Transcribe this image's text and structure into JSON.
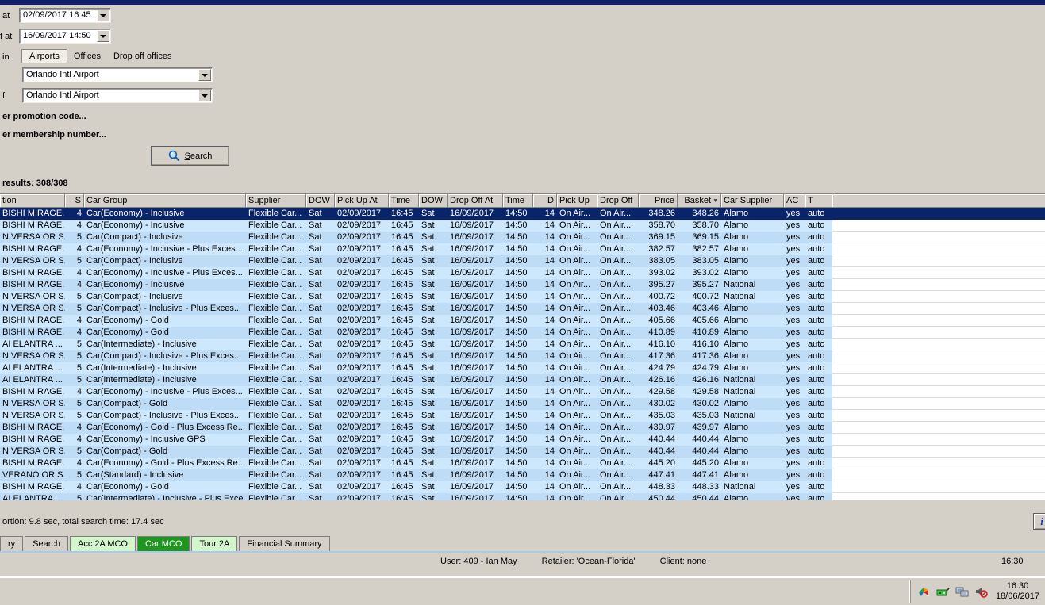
{
  "form": {
    "pickup_at_label": "at",
    "pickup_at_value": "02/09/2017 16:45",
    "dropoff_at_label": "f at",
    "dropoff_at_value": "16/09/2017 14:50",
    "location_in_label": "in",
    "location_tabs": [
      "Airports",
      "Offices",
      "Drop off offices"
    ],
    "active_location_tab": "Airports",
    "pickup_location_value": "Orlando Intl Airport",
    "dropoff_location_label": "f",
    "dropoff_location_value": "Orlando Intl Airport",
    "promotion_link": "er promotion code...",
    "membership_link": "er membership number...",
    "search_button_label": "Search",
    "results_count": "results: 308/308"
  },
  "table": {
    "headers": [
      "tion",
      "S",
      "Car Group",
      "Supplier",
      "DOW",
      "Pick Up At",
      "Time",
      "DOW",
      "Drop Off At",
      "Time",
      "D",
      "Pick Up",
      "Drop Off",
      "Price",
      "Basket",
      "Car Supplier",
      "AC",
      "T"
    ],
    "sorted_by": "Basket",
    "common": {
      "supplier": "Flexible Car...",
      "dow_pickup": "Sat",
      "pickup_date": "02/09/2017",
      "pickup_time": "16:45",
      "dow_dropoff": "Sat",
      "dropoff_date": "16/09/2017",
      "dropoff_time": "14:50",
      "days": "14",
      "pickup_loc": "On Air...",
      "dropoff_loc": "On Air...",
      "ac": "yes",
      "t": "auto"
    },
    "rows": [
      {
        "description": "BISHI MIRAGE...",
        "s": "4",
        "car_group": "Car(Economy) - Inclusive",
        "price": "348.26",
        "basket": "348.26",
        "car_supplier": "Alamo",
        "selected": true
      },
      {
        "description": "BISHI MIRAGE...",
        "s": "4",
        "car_group": "Car(Economy) - Inclusive",
        "price": "358.70",
        "basket": "358.70",
        "car_supplier": "Alamo"
      },
      {
        "description": "N VERSA OR S...",
        "s": "5",
        "car_group": "Car(Compact) - Inclusive",
        "price": "369.15",
        "basket": "369.15",
        "car_supplier": "Alamo"
      },
      {
        "description": "BISHI MIRAGE...",
        "s": "4",
        "car_group": "Car(Economy) - Inclusive - Plus Exces...",
        "price": "382.57",
        "basket": "382.57",
        "car_supplier": "Alamo"
      },
      {
        "description": "N VERSA OR S...",
        "s": "5",
        "car_group": "Car(Compact) - Inclusive",
        "price": "383.05",
        "basket": "383.05",
        "car_supplier": "Alamo"
      },
      {
        "description": "BISHI MIRAGE...",
        "s": "4",
        "car_group": "Car(Economy) - Inclusive - Plus Exces...",
        "price": "393.02",
        "basket": "393.02",
        "car_supplier": "Alamo"
      },
      {
        "description": "BISHI MIRAGE...",
        "s": "4",
        "car_group": "Car(Economy) - Inclusive",
        "price": "395.27",
        "basket": "395.27",
        "car_supplier": "National"
      },
      {
        "description": "N VERSA OR S...",
        "s": "5",
        "car_group": "Car(Compact) - Inclusive",
        "price": "400.72",
        "basket": "400.72",
        "car_supplier": "National"
      },
      {
        "description": "N VERSA OR S...",
        "s": "5",
        "car_group": "Car(Compact) - Inclusive - Plus Exces...",
        "price": "403.46",
        "basket": "403.46",
        "car_supplier": "Alamo"
      },
      {
        "description": "BISHI MIRAGE...",
        "s": "4",
        "car_group": "Car(Economy) - Gold",
        "price": "405.66",
        "basket": "405.66",
        "car_supplier": "Alamo"
      },
      {
        "description": "BISHI MIRAGE...",
        "s": "4",
        "car_group": "Car(Economy) - Gold",
        "price": "410.89",
        "basket": "410.89",
        "car_supplier": "Alamo"
      },
      {
        "description": "AI ELANTRA ...",
        "s": "5",
        "car_group": "Car(Intermediate) - Inclusive",
        "price": "416.10",
        "basket": "416.10",
        "car_supplier": "Alamo"
      },
      {
        "description": "N VERSA OR S...",
        "s": "5",
        "car_group": "Car(Compact) - Inclusive - Plus Exces...",
        "price": "417.36",
        "basket": "417.36",
        "car_supplier": "Alamo"
      },
      {
        "description": "AI ELANTRA ...",
        "s": "5",
        "car_group": "Car(Intermediate) - Inclusive",
        "price": "424.79",
        "basket": "424.79",
        "car_supplier": "Alamo"
      },
      {
        "description": "AI ELANTRA ...",
        "s": "5",
        "car_group": "Car(Intermediate) - Inclusive",
        "price": "426.16",
        "basket": "426.16",
        "car_supplier": "National"
      },
      {
        "description": "BISHI MIRAGE...",
        "s": "4",
        "car_group": "Car(Economy) - Inclusive - Plus Exces...",
        "price": "429.58",
        "basket": "429.58",
        "car_supplier": "National"
      },
      {
        "description": "N VERSA OR S...",
        "s": "5",
        "car_group": "Car(Compact) - Gold",
        "price": "430.02",
        "basket": "430.02",
        "car_supplier": "Alamo"
      },
      {
        "description": "N VERSA OR S...",
        "s": "5",
        "car_group": "Car(Compact) - Inclusive - Plus Exces...",
        "price": "435.03",
        "basket": "435.03",
        "car_supplier": "National"
      },
      {
        "description": "BISHI MIRAGE...",
        "s": "4",
        "car_group": "Car(Economy) - Gold - Plus Excess Re...",
        "price": "439.97",
        "basket": "439.97",
        "car_supplier": "Alamo"
      },
      {
        "description": "BISHI MIRAGE...",
        "s": "4",
        "car_group": "Car(Economy) - Inclusive GPS",
        "price": "440.44",
        "basket": "440.44",
        "car_supplier": "Alamo"
      },
      {
        "description": "N VERSA OR S...",
        "s": "5",
        "car_group": "Car(Compact) - Gold",
        "price": "440.44",
        "basket": "440.44",
        "car_supplier": "Alamo"
      },
      {
        "description": "BISHI MIRAGE...",
        "s": "4",
        "car_group": "Car(Economy) - Gold - Plus Excess Re...",
        "price": "445.20",
        "basket": "445.20",
        "car_supplier": "Alamo"
      },
      {
        "description": "VERANO OR S...",
        "s": "5",
        "car_group": "Car(Standard) - Inclusive",
        "price": "447.41",
        "basket": "447.41",
        "car_supplier": "Alamo"
      },
      {
        "description": "BISHI MIRAGE...",
        "s": "4",
        "car_group": "Car(Economy) - Gold",
        "price": "448.33",
        "basket": "448.33",
        "car_supplier": "National"
      },
      {
        "description": "AI ELANTRA ...",
        "s": "5",
        "car_group": "Car(Intermediate) - Inclusive - Plus Exce...",
        "price": "450.44",
        "basket": "450.44",
        "car_supplier": "Alamo"
      }
    ]
  },
  "status": {
    "search_time": "ortion: 9.8 sec, total search time: 17.4 sec",
    "info_button": "i"
  },
  "bottom_tabs": [
    {
      "label": "ry",
      "style": "plain"
    },
    {
      "label": "Search",
      "style": "plain"
    },
    {
      "label": "Acc 2A MCO",
      "style": "lgreen"
    },
    {
      "label": "Car MCO",
      "style": "agreen",
      "active": true
    },
    {
      "label": "Tour 2A",
      "style": "lgreen"
    },
    {
      "label": "Financial Summary",
      "style": "plain"
    }
  ],
  "status_bar": {
    "user": "User: 409 - Ian May",
    "retailer": "Retailer: 'Ocean-Florida'",
    "client": "Client: none",
    "time": "16:30"
  },
  "taskbar": {
    "tray_icons": [
      "antivirus-icon",
      "network-card-icon",
      "network-computers-icon",
      "volume-muted-icon"
    ],
    "time": "16:30",
    "date": "18/06/2017"
  },
  "colors": {
    "app_background": "#d4d0c8",
    "top_strip": "#101f6b",
    "selected_row": "#0a246a",
    "row_blue_a": "#bfdcf7",
    "row_blue_b": "#cde7fd",
    "active_tab_green": "#1f9620",
    "light_tab_green": "#d2f5cb",
    "tab_underline_blue": "#a9c9ee"
  }
}
